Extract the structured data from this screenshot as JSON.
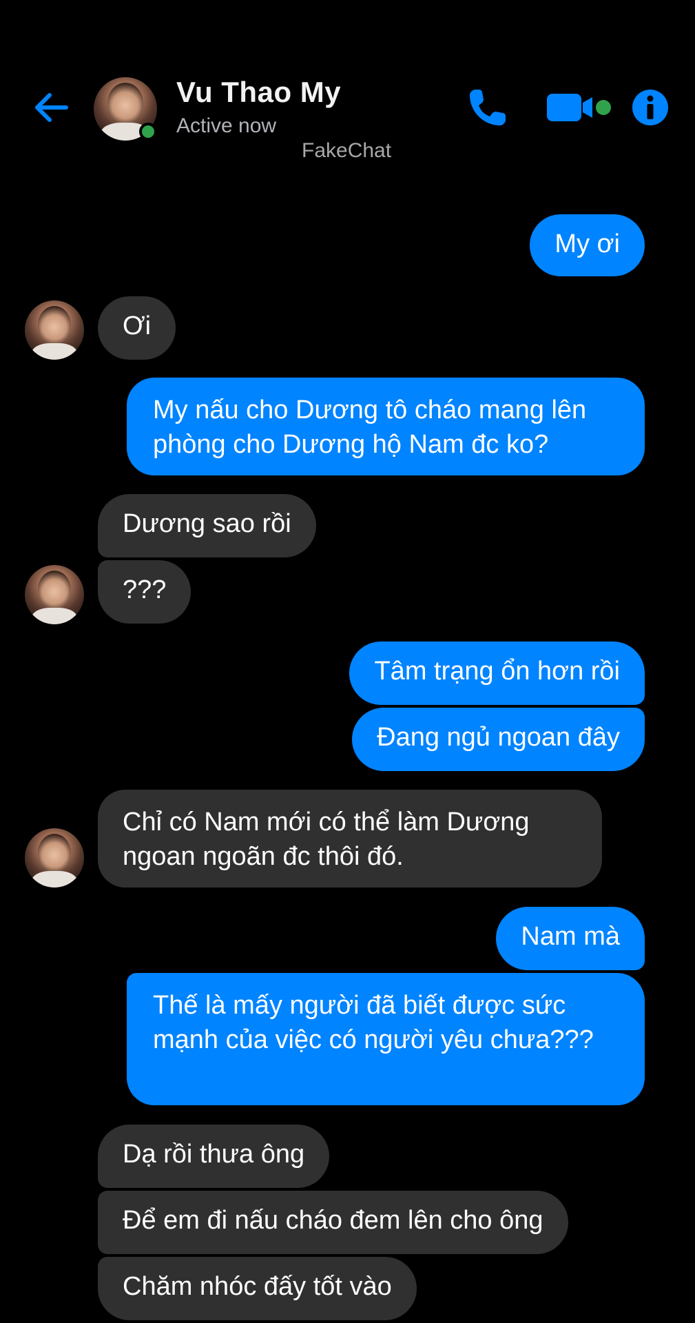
{
  "header": {
    "contact_name": "Vu Thao My",
    "status": "Active now",
    "watermark": "FakeChat",
    "icons": {
      "back": "back-arrow-icon",
      "phone": "phone-icon",
      "video": "video-camera-icon",
      "info": "info-icon"
    },
    "accent_color": "#0084ff",
    "online_color": "#31a24c"
  },
  "messages": [
    {
      "direction": "outgoing",
      "text": "My ơi"
    },
    {
      "direction": "incoming",
      "text": "Ơi"
    },
    {
      "direction": "outgoing",
      "text": "My nấu cho Dương tô cháo mang lên phòng cho Dương hộ Nam đc ko?"
    },
    {
      "direction": "incoming",
      "text": "Dương sao rồi"
    },
    {
      "direction": "incoming",
      "text": "???"
    },
    {
      "direction": "outgoing",
      "text": "Tâm trạng ổn hơn rồi"
    },
    {
      "direction": "outgoing",
      "text": "Đang ngủ ngoan đây"
    },
    {
      "direction": "incoming",
      "text": "Chỉ có Nam mới có thể làm Dương ngoan ngoãn đc thôi đó."
    },
    {
      "direction": "outgoing",
      "text": "Nam mà"
    },
    {
      "direction": "outgoing",
      "text": "Thế là mấy người đã biết được sức mạnh của việc có người yêu chưa???"
    },
    {
      "direction": "incoming",
      "text": "Dạ rồi thưa ông"
    },
    {
      "direction": "incoming",
      "text": "Để em đi nấu cháo đem lên cho ông"
    },
    {
      "direction": "incoming",
      "text": "Chăm nhóc đấy tốt vào"
    }
  ],
  "colors": {
    "outgoing_bubble": "#0084ff",
    "incoming_bubble": "#303030",
    "background": "#000000"
  }
}
